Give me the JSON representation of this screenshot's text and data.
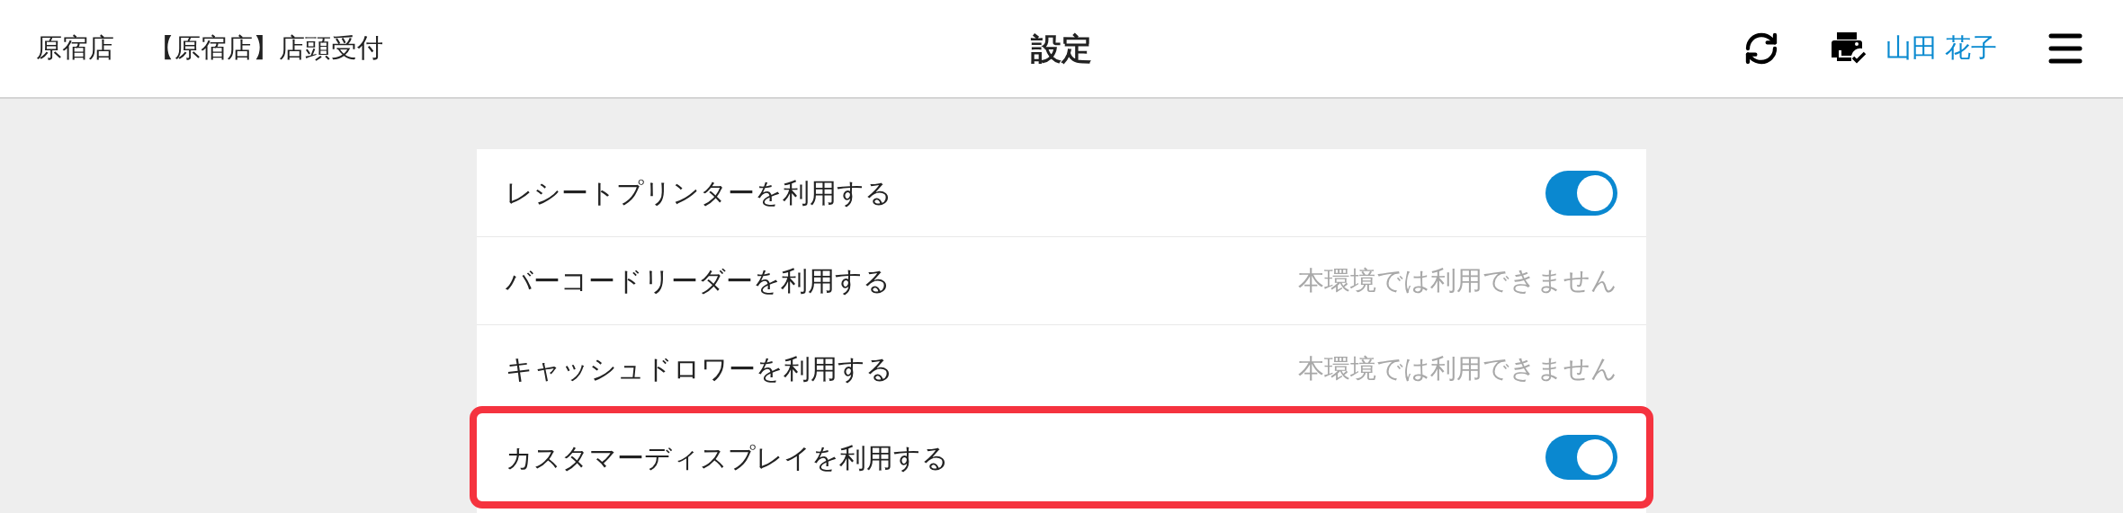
{
  "header": {
    "store": "原宿店",
    "terminal": "【原宿店】店頭受付",
    "title": "設定",
    "user": "山田 花子"
  },
  "settings": [
    {
      "label": "レシートプリンターを利用する",
      "kind": "toggle",
      "on": true,
      "highlighted": false
    },
    {
      "label": "バーコードリーダーを利用する",
      "kind": "unavailable",
      "note": "本環境では利用できません",
      "highlighted": false
    },
    {
      "label": "キャッシュドロワーを利用する",
      "kind": "unavailable",
      "note": "本環境では利用できません",
      "highlighted": false
    },
    {
      "label": "カスタマーディスプレイを利用する",
      "kind": "toggle",
      "on": true,
      "highlighted": true
    }
  ]
}
